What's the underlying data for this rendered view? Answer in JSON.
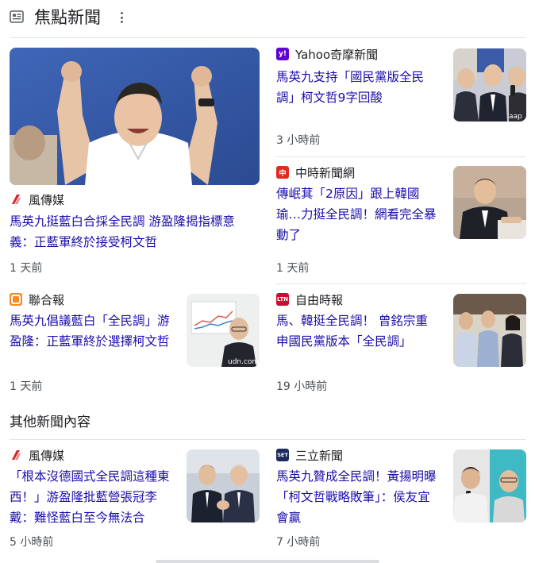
{
  "header": {
    "title": "焦點新聞",
    "icon": "news-icon",
    "more_icon": "more-vert-icon"
  },
  "top_stories": [
    {
      "source": "風傳媒",
      "logo_icon": "storm-media-logo",
      "headline": "馬英九挺藍白合採全民調 游盈隆揭指標意義：正藍軍終於接受柯文哲",
      "time": "1 天前"
    },
    {
      "source": "Yahoo奇摩新聞",
      "logo_icon": "yahoo-logo",
      "logo_text": "y!",
      "headline": "馬英九支持「國民黨版全民調」柯文哲9字回酸",
      "time": "3 小時前",
      "thumb_caption": "aap"
    },
    {
      "source": "中時新聞網",
      "logo_icon": "chinatimes-logo",
      "logo_text": "中",
      "headline": "傳岷萁「2原因」跟上韓國瑜…力挺全民調！網看完全暴動了",
      "time": "1 天前"
    },
    {
      "source": "聯合報",
      "logo_icon": "udn-logo",
      "headline": "馬英九倡議藍白「全民調」游盈隆：正藍軍終於選擇柯文哲",
      "time": "1 天前",
      "thumb_caption": "udn.com"
    },
    {
      "source": "自由時報",
      "logo_icon": "ltn-logo",
      "logo_text": "LTN",
      "headline": "馬、韓挺全民調！ 曾銘宗重申國民黨版本「全民調」",
      "time": "19 小時前"
    }
  ],
  "other_section": {
    "title": "其他新聞內容"
  },
  "other_stories": [
    {
      "source": "風傳媒",
      "logo_icon": "storm-media-logo",
      "headline": "「根本沒德國式全民調這種東西！」游盈隆批藍營張冠李戴：難怪藍白至今無法合",
      "time": "5 小時前"
    },
    {
      "source": "三立新聞",
      "logo_icon": "setn-logo",
      "logo_text": "SET",
      "headline": "馬英九贊成全民調！黃揚明曝「柯文哲戰略敗筆」：侯友宜會贏",
      "time": "7 小時前"
    }
  ]
}
